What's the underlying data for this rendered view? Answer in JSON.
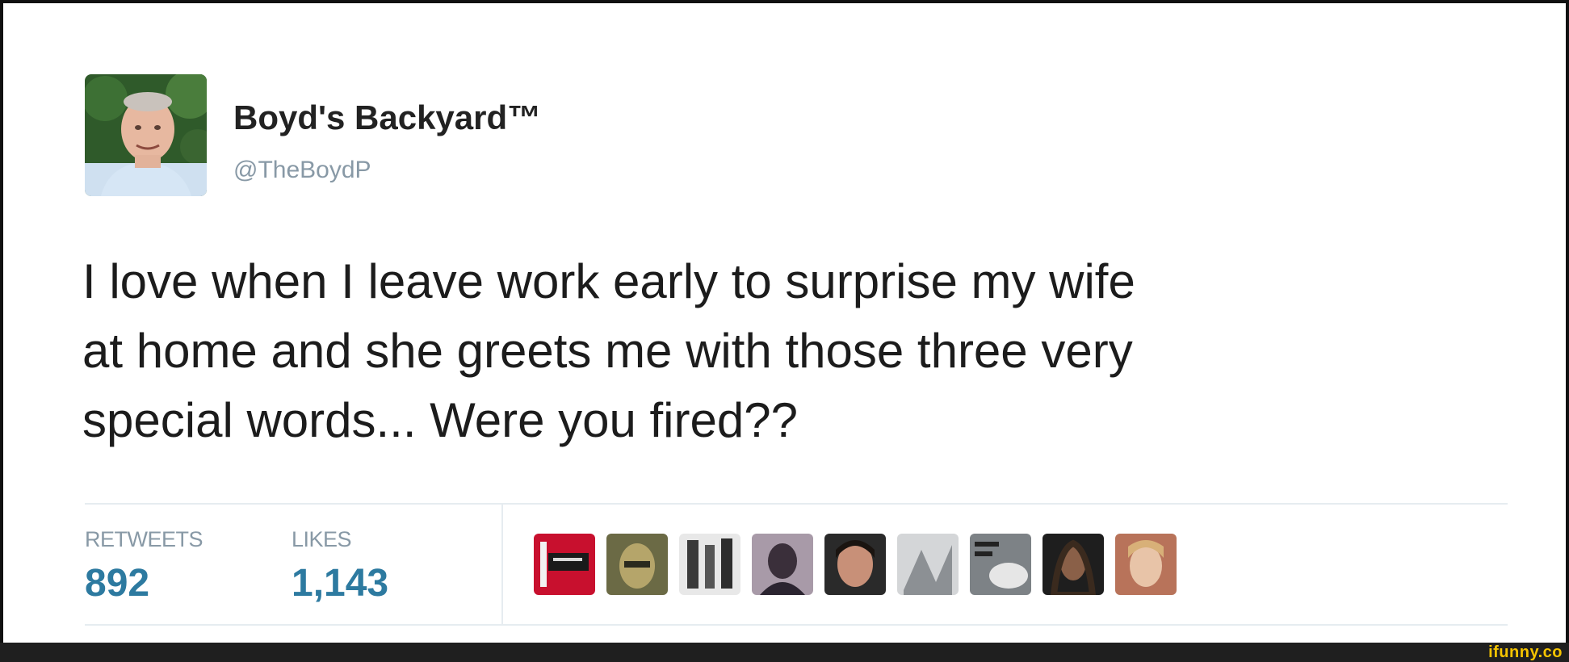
{
  "tweet": {
    "display_name": "Boyd's Backyard™",
    "handle": "@TheBoydP",
    "text_lines": [
      "I love when I leave work early to surprise my wife",
      "at home and she greets me with those three very",
      "special words... Were you fired??"
    ]
  },
  "stats": {
    "retweets_label": "RETWEETS",
    "retweets_value": "892",
    "likes_label": "LIKES",
    "likes_value": "1,143"
  },
  "likers": [
    {
      "name": "liker-avatar-1"
    },
    {
      "name": "liker-avatar-2"
    },
    {
      "name": "liker-avatar-3"
    },
    {
      "name": "liker-avatar-4"
    },
    {
      "name": "liker-avatar-5"
    },
    {
      "name": "liker-avatar-6"
    },
    {
      "name": "liker-avatar-7"
    },
    {
      "name": "liker-avatar-8"
    },
    {
      "name": "liker-avatar-9"
    }
  ],
  "watermark": "ifunny.co",
  "colors": {
    "stat_value": "#2d7aa0",
    "muted": "#8899a6",
    "text": "#1c1c1c",
    "watermark": "#f5c400"
  }
}
